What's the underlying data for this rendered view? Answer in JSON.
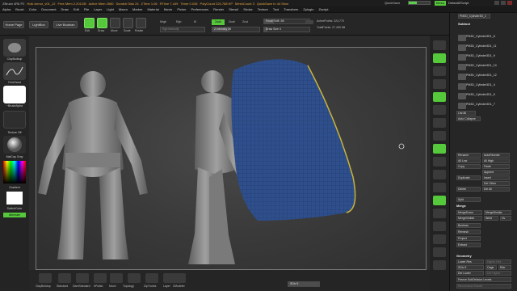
{
  "titlebar": {
    "segments": [
      "ZBrush 4R6 P2",
      "Hulk Armor_v01_12",
      "Free Mem 2.201GB",
      "Active Mem 2660",
      "Scratch Disk 24",
      "ZTime 1.06",
      "RTime 7.449",
      "Timer 0.035",
      "PolyCount 224.768 KP",
      "MeshCount 3",
      "QuickSave In 44 Secs"
    ],
    "quicksave_label": "QuickSave",
    "seethrough_label": "See-through 0",
    "menus_button": "Menus",
    "default_script": "DefaultZScript"
  },
  "menubar": [
    "Alpha",
    "Brush",
    "Color",
    "Document",
    "Draw",
    "Edit",
    "File",
    "Layer",
    "Light",
    "Macro",
    "Marker",
    "Material",
    "Movie",
    "Picker",
    "Preferences",
    "Render",
    "Stencil",
    "Stroke",
    "Texture",
    "Tool",
    "Transform",
    "Zplugin",
    "Zscript"
  ],
  "shelf": {
    "home_page": "Home Page",
    "lightbox": "LightBox",
    "live_boolean": "Live Boolean",
    "tools": [
      "Edit",
      "Draw",
      "Move",
      "Scale",
      "Rotate"
    ],
    "mrgb": "Mrgb",
    "rgb": "Rgb",
    "m": "M",
    "rgb_intensity": "Rgb Intensity",
    "zadd": "Zadd",
    "zsub": "Zsub",
    "zcut": "Zcut",
    "z_intensity": "Z Intensity 36",
    "focal_shift": "Focal Shift -56",
    "draw_size": "Draw Size 4",
    "active_points": "ActivePoints: 224,770",
    "total_points": "TotalPoints: 27.490 Mil"
  },
  "leftshelf": {
    "items": [
      "ClayBuildup",
      "FreeHand",
      "~BrushAlpha",
      "Texture Off",
      "MatCap Gray"
    ],
    "gradient_label": "Gradient",
    "switch_color": "SwitchColor",
    "alternate": "Alternate"
  },
  "bottomshelf": {
    "items": [
      "ClayBuildup",
      "Standard",
      "DamStandard",
      "hPolish",
      "Move",
      "Topology",
      "ZipTrunks",
      "Layer",
      "ZModeler"
    ],
    "sdiv_label": "SDiv 5"
  },
  "righticons": [
    "BPR",
    "SPix 3",
    "Scroll",
    "Zoom",
    "Actual",
    "AAHalf",
    "Persp",
    "Floor",
    "Local",
    "LSym",
    "Xyz",
    "Frame",
    "Move",
    "Scale",
    "Rotate",
    "PolyF",
    "Transp",
    "Solo"
  ],
  "tray": {
    "tool_name": "PM3D_Cylinder3D_1",
    "subtool_header": "Subtool",
    "subtools": [
      "PM3D_Cylinder3D1_8",
      "PM3D_Cylinder3D1_11",
      "PM3D_Cylinder3D1_9",
      "PM3D_Cylinder3D1_10",
      "PM3D_Cylinder3D1_12",
      "PM3D_Cylinder3D1_4",
      "PM3D_Cylinder3D1_5",
      "PM3D_Cylinder3D1_7"
    ],
    "list_all": "List All",
    "auto_collapse": "Auto Collapse",
    "rename": "Rename",
    "autoreorder": "AutoReorder",
    "all_low": "All Low",
    "all_high": "All High",
    "copy": "Copy",
    "paste": "Paste",
    "append": "Append",
    "duplicate": "Duplicate",
    "insert": "Insert",
    "del_other": "Del Other",
    "delete": "Delete",
    "del_all": "Del All",
    "split": "Split",
    "merge_header": "Merge",
    "merge_down": "MergeDown",
    "merge_similar": "MergeSimilar",
    "merge_visible": "MergeVisible",
    "weld": "Weld",
    "uv": "Uv",
    "boolean": "Boolean",
    "remesh": "Remesh",
    "project": "Project",
    "extract": "Extract",
    "geometry_header": "Geometry",
    "lower_res": "Lower Res",
    "higher_res": "Higher Res",
    "sdiv": "SDiv 5",
    "cage": "Cage",
    "rstr": "Rstr",
    "del_lower": "Del Lower",
    "del_higher": "Del Higher",
    "freeze_subdiv": "Freeze SubDivision Levels",
    "reconstruct_subdiv": "Reconstruct Subdiv"
  },
  "colors": {
    "accent_green": "#55c83b",
    "mesh_blue": "#2f4f8c",
    "sculpt_gray": "#8a8a8a",
    "panel_bg": "#262626"
  }
}
